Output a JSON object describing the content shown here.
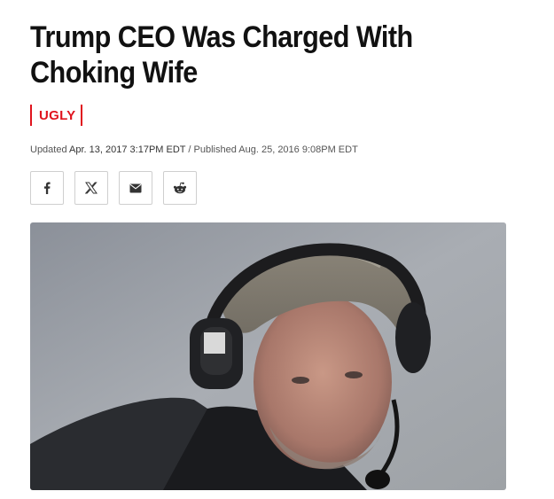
{
  "article": {
    "headline": "Trump CEO Was Charged With Choking Wife",
    "category": "UGLY",
    "updated_label": "Updated",
    "updated_date": "Apr. 13, 2017 3:17PM EDT",
    "separator": "/",
    "published_label": "Published",
    "published_date": "Aug. 25, 2016 9:08PM EDT"
  },
  "share": {
    "buttons": [
      {
        "icon": "facebook-icon"
      },
      {
        "icon": "x-icon"
      },
      {
        "icon": "email-icon"
      },
      {
        "icon": "reddit-icon"
      }
    ]
  },
  "colors": {
    "accent": "#e0141e",
    "text": "#111111",
    "meta": "#555555",
    "border": "#cfcfcf"
  },
  "image": {
    "description_icon": "photo"
  }
}
